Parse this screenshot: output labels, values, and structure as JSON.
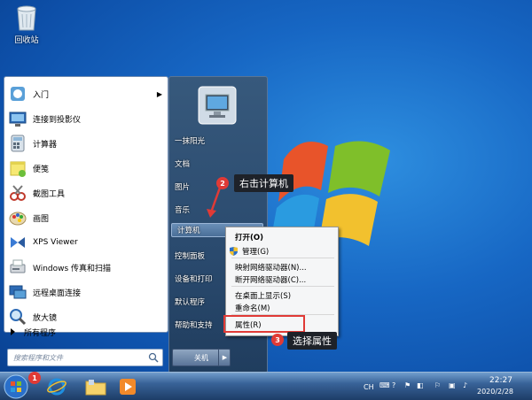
{
  "desktop": {
    "recycle_bin_label": "回收站"
  },
  "start_menu": {
    "programs": [
      {
        "label": "入门",
        "icon": "getting-started-icon",
        "has_submenu": true
      },
      {
        "label": "连接到投影仪",
        "icon": "projector-icon"
      },
      {
        "label": "计算器",
        "icon": "calculator-icon"
      },
      {
        "label": "便笺",
        "icon": "sticky-notes-icon"
      },
      {
        "label": "截图工具",
        "icon": "snipping-tool-icon"
      },
      {
        "label": "画图",
        "icon": "paint-icon"
      },
      {
        "label": "XPS Viewer",
        "icon": "xps-viewer-icon"
      },
      {
        "label": "Windows 传真和扫描",
        "icon": "fax-scan-icon"
      },
      {
        "label": "远程桌面连接",
        "icon": "remote-desktop-icon"
      },
      {
        "label": "放大镜",
        "icon": "magnifier-icon"
      }
    ],
    "all_programs_label": "所有程序",
    "search_placeholder": "搜索程序和文件",
    "right_items": [
      {
        "label": "一抹阳光"
      },
      {
        "label": "文档"
      },
      {
        "label": "图片"
      },
      {
        "label": "音乐"
      },
      {
        "label": "计算机"
      },
      {
        "label": "控制面板"
      },
      {
        "label": "设备和打印"
      },
      {
        "label": "默认程序"
      },
      {
        "label": "帮助和支持"
      }
    ],
    "shutdown_label": "关机"
  },
  "context_menu": {
    "items": [
      {
        "label": "打开(O)",
        "bold": true
      },
      {
        "label": "管理(G)"
      },
      {
        "label": "映射网络驱动器(N)..."
      },
      {
        "label": "断开网络驱动器(C)..."
      },
      {
        "label": "在桌面上显示(S)"
      },
      {
        "label": "重命名(M)"
      },
      {
        "label": "属性(R)"
      }
    ]
  },
  "annotations": {
    "step1": "1",
    "step2": "2",
    "step2_text": "右击计算机",
    "step3": "3",
    "step3_text": "选择属性"
  },
  "taskbar": {
    "tray_lang": "CH",
    "time": "22:27",
    "date": "2020/2/28"
  }
}
